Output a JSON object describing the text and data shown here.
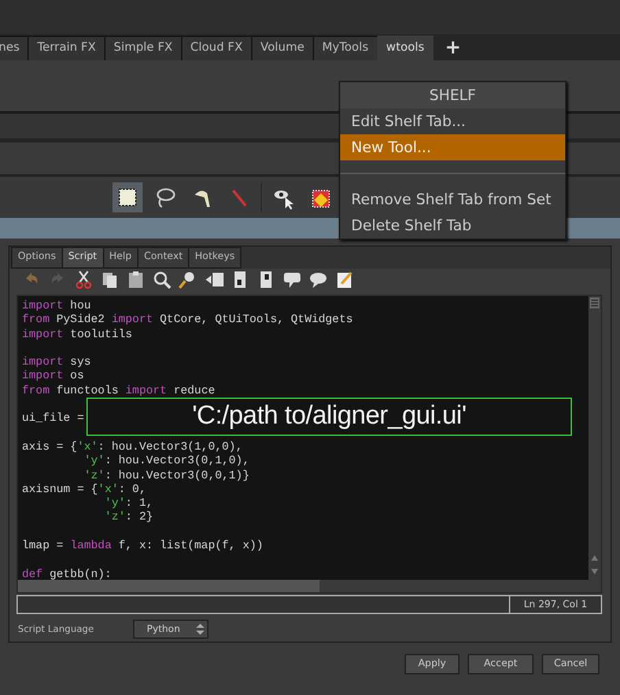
{
  "shelf_tabs": [
    {
      "label": "nes",
      "selected": false
    },
    {
      "label": "Terrain FX",
      "selected": false
    },
    {
      "label": "Simple FX",
      "selected": false
    },
    {
      "label": "Cloud FX",
      "selected": false
    },
    {
      "label": "Volume",
      "selected": false
    },
    {
      "label": "MyTools",
      "selected": false
    },
    {
      "label": "wtools",
      "selected": true
    }
  ],
  "add_tab_button": "+",
  "shelf_tools": [
    {
      "selected": true
    },
    {
      "selected": false
    },
    {
      "selected": false
    },
    {
      "selected": false
    },
    {
      "selected": false
    },
    {
      "selected": false
    }
  ],
  "context_menu": {
    "title": "SHELF",
    "items": [
      {
        "kind": "item",
        "label": "Edit Shelf Tab...",
        "selected": false
      },
      {
        "kind": "item",
        "label": "New Tool...",
        "selected": true
      },
      {
        "kind": "separator"
      },
      {
        "kind": "item",
        "label": "Remove Shelf Tab from Set",
        "selected": false
      },
      {
        "kind": "item",
        "label": "Delete Shelf Tab",
        "selected": false
      }
    ]
  },
  "dialog": {
    "tabs": [
      {
        "label": "Options",
        "selected": false
      },
      {
        "label": "Script",
        "selected": true
      },
      {
        "label": "Help",
        "selected": false
      },
      {
        "label": "Context",
        "selected": false
      },
      {
        "label": "Hotkeys",
        "selected": false
      }
    ],
    "code_lines": [
      {
        "kind": "code",
        "segments": [
          {
            "kind": "keyword",
            "text": "import"
          },
          {
            "kind": "plain",
            "text": " hou"
          }
        ]
      },
      {
        "kind": "code",
        "segments": [
          {
            "kind": "keyword",
            "text": "from"
          },
          {
            "kind": "plain",
            "text": " PySide2 "
          },
          {
            "kind": "keyword",
            "text": "import"
          },
          {
            "kind": "plain",
            "text": " QtCore, QtUiTools, QtWidgets"
          }
        ]
      },
      {
        "kind": "code",
        "segments": [
          {
            "kind": "keyword",
            "text": "import"
          },
          {
            "kind": "plain",
            "text": " toolutils"
          }
        ]
      },
      {
        "kind": "blank"
      },
      {
        "kind": "code",
        "segments": [
          {
            "kind": "keyword",
            "text": "import"
          },
          {
            "kind": "plain",
            "text": " sys"
          }
        ]
      },
      {
        "kind": "code",
        "segments": [
          {
            "kind": "keyword",
            "text": "import"
          },
          {
            "kind": "plain",
            "text": " os"
          }
        ]
      },
      {
        "kind": "code",
        "segments": [
          {
            "kind": "keyword",
            "text": "from"
          },
          {
            "kind": "plain",
            "text": " functools "
          },
          {
            "kind": "keyword",
            "text": "import"
          },
          {
            "kind": "plain",
            "text": " reduce"
          }
        ]
      },
      {
        "kind": "blank"
      },
      {
        "kind": "code",
        "segments": [
          {
            "kind": "plain",
            "text": "ui_file ="
          }
        ]
      },
      {
        "kind": "blank"
      },
      {
        "kind": "code",
        "segments": [
          {
            "kind": "plain",
            "text": "axis = {"
          },
          {
            "kind": "string",
            "text": "'x'"
          },
          {
            "kind": "plain",
            "text": ": hou.Vector3(1,0,0),"
          }
        ]
      },
      {
        "kind": "code",
        "segments": [
          {
            "kind": "string",
            "text": "         'y'"
          },
          {
            "kind": "plain",
            "text": ": hou.Vector3(0,1,0),"
          }
        ]
      },
      {
        "kind": "code",
        "segments": [
          {
            "kind": "string",
            "text": "         'z'"
          },
          {
            "kind": "plain",
            "text": ": hou.Vector3(0,0,1)}"
          }
        ]
      },
      {
        "kind": "code",
        "segments": [
          {
            "kind": "plain",
            "text": "axisnum = {"
          },
          {
            "kind": "string",
            "text": "'x'"
          },
          {
            "kind": "plain",
            "text": ": 0,"
          }
        ]
      },
      {
        "kind": "code",
        "segments": [
          {
            "kind": "string",
            "text": "            'y'"
          },
          {
            "kind": "plain",
            "text": ": 1,"
          }
        ]
      },
      {
        "kind": "code",
        "segments": [
          {
            "kind": "string",
            "text": "            'z'"
          },
          {
            "kind": "plain",
            "text": ": 2}"
          }
        ]
      },
      {
        "kind": "blank"
      },
      {
        "kind": "code",
        "segments": [
          {
            "kind": "plain",
            "text": "lmap = "
          },
          {
            "kind": "keyword",
            "text": "lambda"
          },
          {
            "kind": "plain",
            "text": " f, x: list(map(f, x))"
          }
        ]
      },
      {
        "kind": "blank"
      },
      {
        "kind": "code",
        "segments": [
          {
            "kind": "keyword",
            "text": "def"
          },
          {
            "kind": "plain",
            "text": " getbb(n):"
          }
        ]
      }
    ],
    "overlay_text": "'C:/path to/aligner_gui.ui'",
    "cursor_position": "Ln 297, Col 1",
    "language_label": "Script Language",
    "language_value": "Python",
    "buttons": [
      "Apply",
      "Accept",
      "Cancel"
    ]
  }
}
